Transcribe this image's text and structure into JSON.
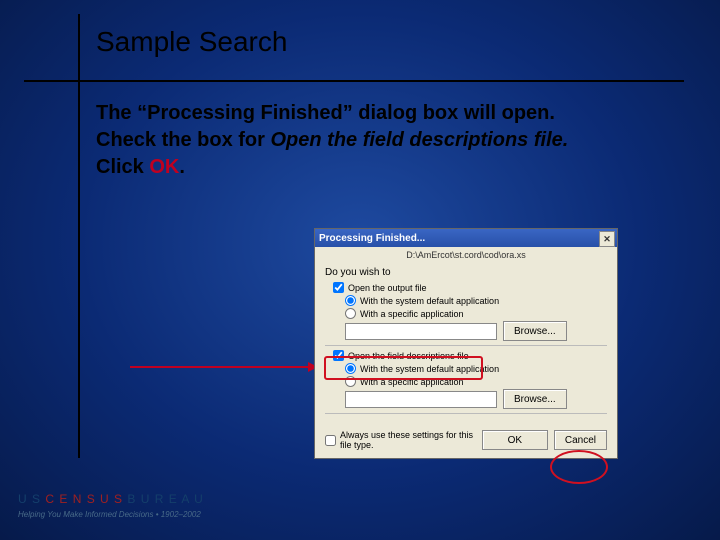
{
  "title": "Sample Search",
  "body": {
    "l1": "The “Processing Finished” dialog box will open.",
    "l2a": "Check the box for ",
    "l2b": "Open the field descriptions file.",
    "l3a": "Click ",
    "l3b": "OK",
    "l3c": "."
  },
  "dialog": {
    "title": "Processing Finished...",
    "close_glyph": "✕",
    "path": "D:\\AmErcot\\st.cord\\cod\\ora.xs",
    "question": "Do you wish to",
    "opt_output": "Open the output file",
    "opt_sys": "With the system default application",
    "opt_spec": "With a specific application",
    "browse": "Browse...",
    "opt_fielddesc": "Open the field descriptions file",
    "opt_sys2": "With the system default application",
    "opt_spec2": "With a specific application",
    "browse2": "Browse...",
    "always": "Always use these settings for this file type.",
    "ok": "OK",
    "cancel": "Cancel"
  },
  "footer": {
    "brand_us": "U S",
    "brand_c": "C E N S U S",
    "brand_b": "B U R E A U",
    "tag": "Helping You Make Informed Decisions • 1902–2002"
  }
}
